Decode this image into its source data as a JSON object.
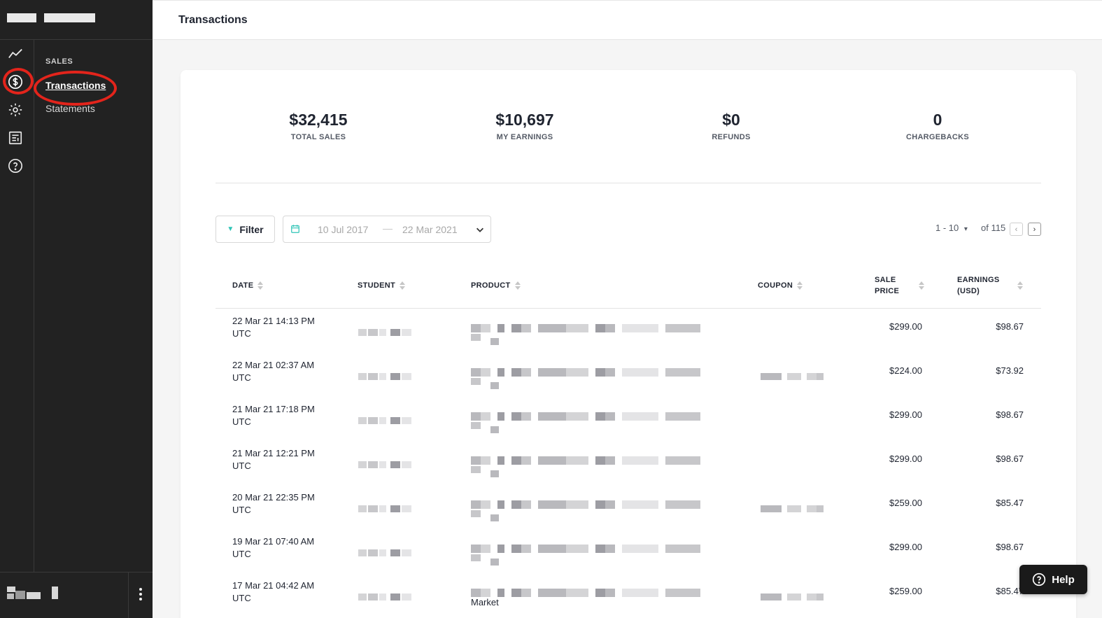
{
  "header": {
    "title": "Transactions"
  },
  "sidebar": {
    "section_label": "SALES",
    "items": [
      {
        "label": "Transactions",
        "active": true
      },
      {
        "label": "Statements",
        "active": false
      }
    ],
    "rail_icons": [
      "analytics-icon",
      "dollar-icon",
      "gear-icon",
      "report-icon",
      "help-circle-icon"
    ]
  },
  "stats": [
    {
      "value": "$32,415",
      "label": "TOTAL SALES"
    },
    {
      "value": "$10,697",
      "label": "MY EARNINGS"
    },
    {
      "value": "$0",
      "label": "REFUNDS"
    },
    {
      "value": "0",
      "label": "CHARGEBACKS"
    }
  ],
  "toolbar": {
    "filter_label": "Filter",
    "date_start": "10 Jul 2017",
    "date_separator": "—",
    "date_end": "22 Mar 2021"
  },
  "pagination": {
    "range": "1 - 10",
    "range_caret": "▾",
    "of": "of 115",
    "prev": "‹",
    "next": "›"
  },
  "table": {
    "columns": {
      "date": "DATE",
      "student": "STUDENT",
      "product": "PRODUCT",
      "coupon": "COUPON",
      "sale_price": [
        "SALE",
        "PRICE"
      ],
      "earnings": [
        "EARNINGS",
        "(USD)"
      ]
    },
    "rows": [
      {
        "date": "22 Mar 21 14:13 PM",
        "tz": "UTC",
        "sale": "$299.00",
        "earn": "$98.67",
        "coupon": false,
        "product_extra": ""
      },
      {
        "date": "22 Mar 21 02:37 AM",
        "tz": "UTC",
        "sale": "$224.00",
        "earn": "$73.92",
        "coupon": true,
        "product_extra": ""
      },
      {
        "date": "21 Mar 21 17:18 PM",
        "tz": "UTC",
        "sale": "$299.00",
        "earn": "$98.67",
        "coupon": false,
        "product_extra": ""
      },
      {
        "date": "21 Mar 21 12:21 PM",
        "tz": "UTC",
        "sale": "$299.00",
        "earn": "$98.67",
        "coupon": false,
        "product_extra": ""
      },
      {
        "date": "20 Mar 21 22:35 PM",
        "tz": "UTC",
        "sale": "$259.00",
        "earn": "$85.47",
        "coupon": true,
        "product_extra": ""
      },
      {
        "date": "19 Mar 21 07:40 AM",
        "tz": "UTC",
        "sale": "$299.00",
        "earn": "$98.67",
        "coupon": false,
        "product_extra": ""
      },
      {
        "date": "17 Mar 21 04:42 AM",
        "tz": "UTC",
        "sale": "$259.00",
        "earn": "$85.47",
        "coupon": true,
        "product_extra": "Market"
      }
    ]
  },
  "help": {
    "label": "Help"
  },
  "colors": {
    "sidebar_bg": "#222222",
    "accent": "#2ec4b6",
    "annotation": "#e3241b"
  }
}
